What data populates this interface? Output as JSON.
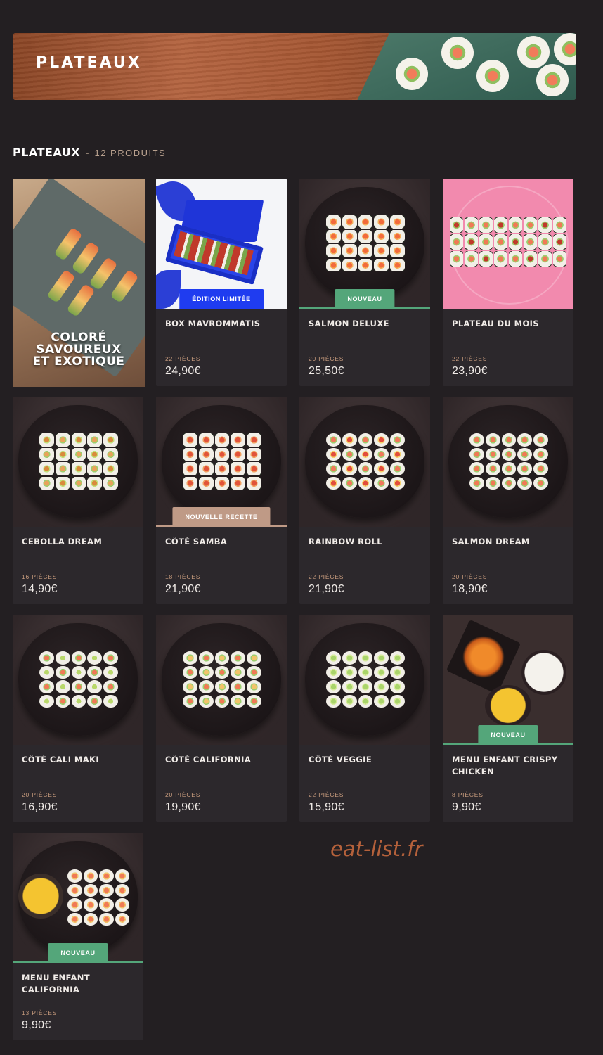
{
  "banner": {
    "title": "PLATEAUX"
  },
  "section": {
    "title": "PLATEAUX",
    "separator": "-",
    "count": "12 PRODUITS"
  },
  "promo": {
    "lines": [
      "COLORÉ",
      "SAVOUREUX",
      "ET EXOTIQUE"
    ]
  },
  "watermark": "eat-list.fr",
  "colors": {
    "badge_green": "#54a67a",
    "badge_blue": "#1f3cf0",
    "badge_beige": "#bf9a86",
    "price_accent": "#c79b7d",
    "background": "#231f22"
  },
  "products": [
    {
      "name": "BOX MAVROMMATIS",
      "pieces": "22 PIÈCES",
      "price": "24,90€",
      "badge": "ÉDITION LIMITÉE",
      "badge_style": "blue",
      "image": "blue-gift-box"
    },
    {
      "name": "SALMON DELUXE",
      "pieces": "20 PIÈCES",
      "price": "25,50€",
      "badge": "NOUVEAU",
      "badge_style": "green",
      "image": "salmon-plate"
    },
    {
      "name": "PLATEAU DU MOIS",
      "pieces": "22 PIÈCES",
      "price": "23,90€",
      "badge": "",
      "badge_style": "",
      "image": "pink-plate"
    },
    {
      "name": "CEBOLLA DREAM",
      "pieces": "16 PIÈCES",
      "price": "14,90€",
      "badge": "",
      "badge_style": "",
      "image": "crispy-rolls-plate"
    },
    {
      "name": "CÔTÉ SAMBA",
      "pieces": "18 PIÈCES",
      "price": "21,90€",
      "badge": "NOUVELLE RECETTE",
      "badge_style": "beige",
      "image": "salmon-rolls-plate"
    },
    {
      "name": "RAINBOW ROLL",
      "pieces": "22 PIÈCES",
      "price": "21,90€",
      "badge": "",
      "badge_style": "",
      "image": "rainbow-plate"
    },
    {
      "name": "SALMON DREAM",
      "pieces": "20 PIÈCES",
      "price": "18,90€",
      "badge": "",
      "badge_style": "",
      "image": "salmon-dream-plate"
    },
    {
      "name": "CÔTÉ CALI MAKI",
      "pieces": "20 PIÈCES",
      "price": "16,90€",
      "badge": "",
      "badge_style": "",
      "image": "maki-plate"
    },
    {
      "name": "CÔTÉ CALIFORNIA",
      "pieces": "20 PIÈCES",
      "price": "19,90€",
      "badge": "",
      "badge_style": "",
      "image": "california-plate"
    },
    {
      "name": "CÔTÉ VEGGIE",
      "pieces": "22 PIÈCES",
      "price": "15,90€",
      "badge": "",
      "badge_style": "",
      "image": "veggie-plate"
    },
    {
      "name": "MENU ENFANT CRISPY CHICKEN",
      "pieces": "8 PIÈCES",
      "price": "9,90€",
      "badge": "NOUVEAU",
      "badge_style": "green",
      "image": "crispy-chicken-menu"
    },
    {
      "name": "MENU ENFANT CALIFORNIA",
      "pieces": "13 PIÈCES",
      "price": "9,90€",
      "badge": "NOUVEAU",
      "badge_style": "green",
      "image": "kids-california-menu"
    }
  ]
}
